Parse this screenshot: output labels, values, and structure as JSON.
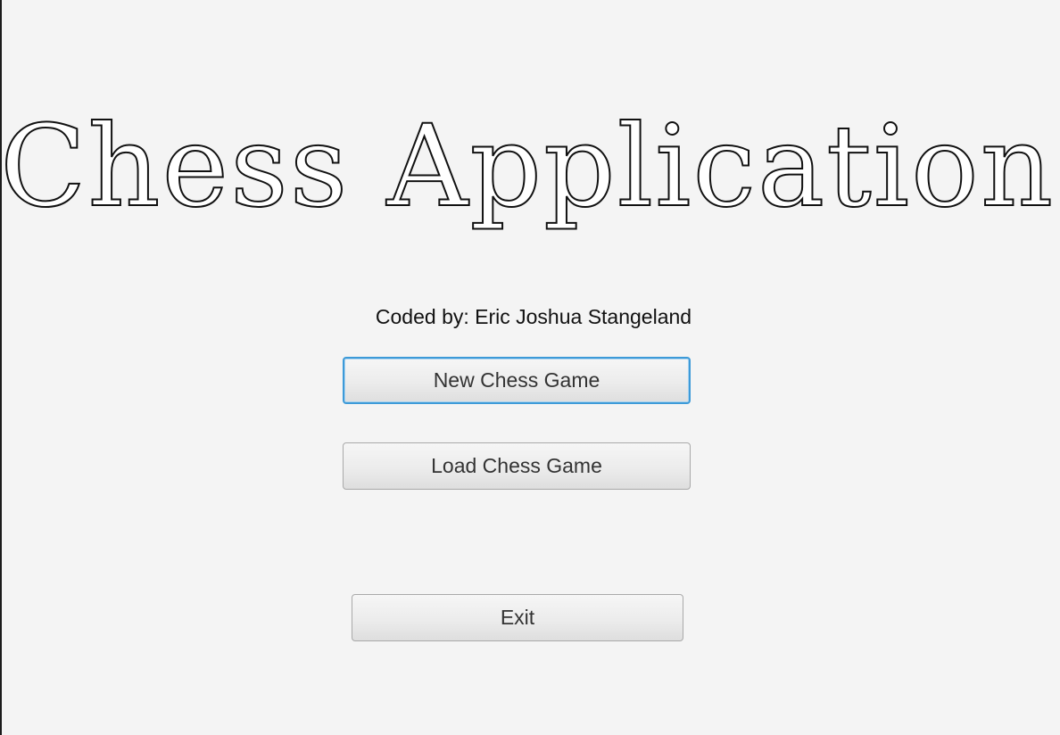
{
  "title": "Chess Application",
  "credit": "Coded by: Eric Joshua Stangeland",
  "buttons": {
    "new_game": "New Chess Game",
    "load_game": "Load Chess Game",
    "exit": "Exit"
  },
  "colors": {
    "background": "#f4f4f4",
    "focus_ring": "#3d9ad8",
    "button_text": "#333333"
  },
  "focused_button": "new_game"
}
